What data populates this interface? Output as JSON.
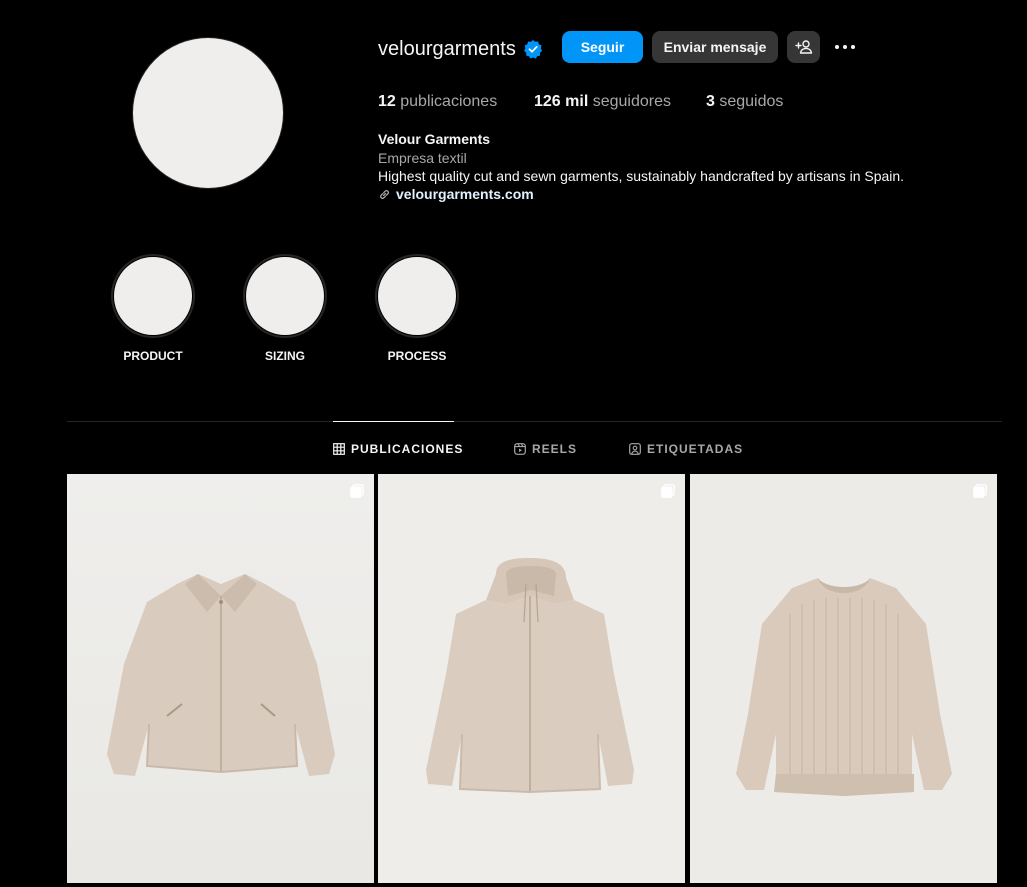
{
  "profile": {
    "username": "velourgarments",
    "verified": true,
    "buttons": {
      "follow": "Seguir",
      "message": "Enviar mensaje",
      "add_user_icon": "add-user-icon",
      "more_icon": "more-options-icon"
    },
    "stats": {
      "posts_count": "12",
      "posts_label": "publicaciones",
      "followers_count": "126 mil",
      "followers_label": "seguidores",
      "following_count": "3",
      "following_label": "seguidos"
    },
    "bio": {
      "name": "Velour Garments",
      "category": "Empresa textil",
      "text": "Highest quality cut and sewn garments, sustainably handcrafted by artisans in Spain.",
      "link": "velourgarments.com"
    }
  },
  "highlights": [
    {
      "label": "PRODUCT"
    },
    {
      "label": "SIZING"
    },
    {
      "label": "PROCESS"
    }
  ],
  "tabs": [
    {
      "label": "PUBLICACIONES",
      "icon": "grid-icon",
      "active": true
    },
    {
      "label": "REELS",
      "icon": "reels-icon",
      "active": false
    },
    {
      "label": "ETIQUETADAS",
      "icon": "tagged-icon",
      "active": false
    }
  ],
  "posts": [
    {
      "item": "zip jacket with collar",
      "type": "carousel"
    },
    {
      "item": "hooded zip jacket",
      "type": "carousel"
    },
    {
      "item": "ribbed knit sweater",
      "type": "carousel"
    }
  ],
  "colors": {
    "accent": "#0095f6",
    "background": "#000000",
    "button_secondary": "#363636",
    "garment": "#d9cbbd"
  }
}
